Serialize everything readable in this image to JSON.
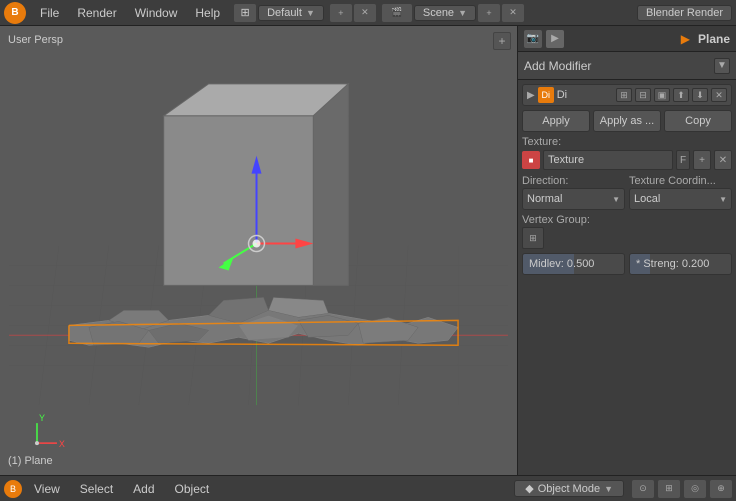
{
  "topbar": {
    "logo": "B",
    "menus": [
      "File",
      "Render",
      "Window",
      "Help"
    ],
    "layout_label": "Default",
    "scene_label": "Scene",
    "engine_label": "Blender Render"
  },
  "viewport": {
    "label": "User Persp",
    "add_btn": "+"
  },
  "right_panel": {
    "plane_icon": "▶",
    "plane_label": "Plane",
    "add_modifier_label": "Add Modifier",
    "add_modifier_icon": "▼",
    "mod_arrow": "▶",
    "mod_di_label": "Di",
    "mod_icons": [
      "⊞",
      "⊟",
      "▣",
      "✕"
    ],
    "action_buttons": [
      "Apply",
      "Apply as ...",
      "Copy"
    ],
    "texture_label": "Texture:",
    "texture_name": "Texture",
    "texture_f": "F",
    "direction_label": "Direction:",
    "direction_value": "Normal",
    "texture_coord_label": "Texture Coordin...",
    "texture_coord_value": "Local",
    "vertex_group_label": "Vertex Group:",
    "midlev_label": "Midlev: 0.500",
    "streng_label": "* Streng: 0.200",
    "midlev_pct": 50,
    "streng_pct": 20
  },
  "bottombar": {
    "logo": "B",
    "menus": [
      "View",
      "Select",
      "Add",
      "Object"
    ],
    "mode_icon": "◆",
    "mode_label": "Object Mode",
    "status": "(1) Plane"
  }
}
